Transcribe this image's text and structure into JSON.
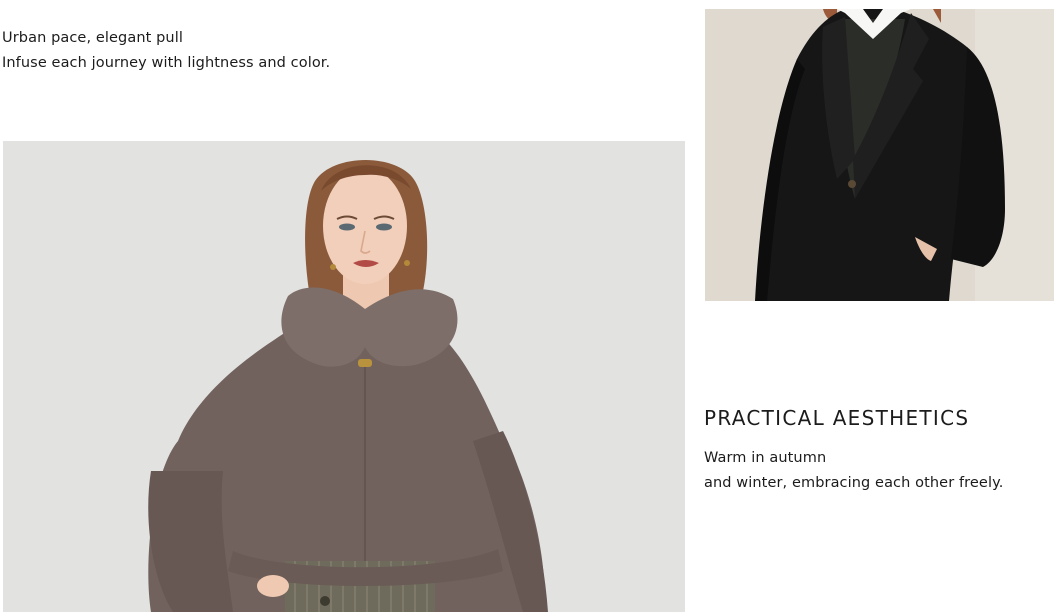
{
  "intro": {
    "line1": "Urban pace, elegant pull",
    "line2": "Infuse each journey with lightness and color."
  },
  "images": {
    "fur_jacket": {
      "subject": "model in taupe faux-fur cropped jacket",
      "background_color": "#e2e2e0"
    },
    "black_coat": {
      "subject": "model in black wool coat with white collar",
      "background_color": "#dfd9cf"
    }
  },
  "aesthetics": {
    "heading": "PRACTICAL AESTHETICS",
    "line1": "Warm in autumn",
    "line2": "and winter, embracing each other freely."
  }
}
